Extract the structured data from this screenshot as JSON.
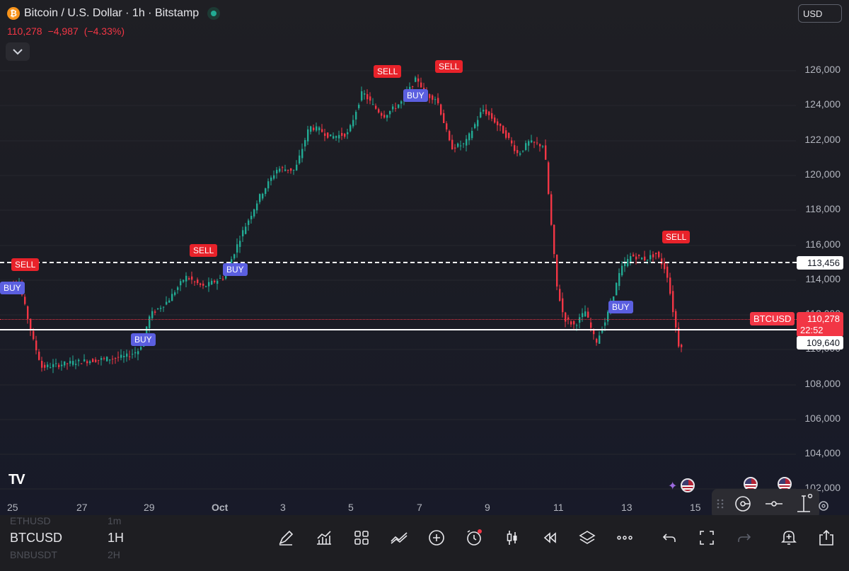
{
  "header": {
    "title": "Bitcoin / U.S. Dollar · 1h · Bitstamp",
    "last_price": "110,278",
    "change": "−4,987",
    "change_pct": "(−4.33%)",
    "currency": "USD",
    "logo_glyph": "₿"
  },
  "chart": {
    "y_ticks": [
      "126,000",
      "124,000",
      "122,000",
      "120,000",
      "118,000",
      "116,000",
      "114,000",
      "112,000",
      "110,000",
      "108,000",
      "106,000",
      "104,000",
      "102,000"
    ],
    "x_ticks": [
      "25",
      "27",
      "29",
      "Oct",
      "3",
      "5",
      "7",
      "9",
      "11",
      "13",
      "15"
    ],
    "price_tags": {
      "resistance": "113,456",
      "support": "109,640",
      "symbol": "BTCUSD",
      "current": "110,278",
      "countdown": "22:52"
    },
    "signals": [
      {
        "label": "SELL",
        "type": "sell"
      },
      {
        "label": "BUY",
        "type": "buy"
      },
      {
        "label": "BUY",
        "type": "buy"
      },
      {
        "label": "SELL",
        "type": "sell"
      },
      {
        "label": "BUY",
        "type": "buy"
      },
      {
        "label": "SELL",
        "type": "sell"
      },
      {
        "label": "BUY",
        "type": "buy"
      },
      {
        "label": "SELL",
        "type": "sell"
      },
      {
        "label": "BUY",
        "type": "buy"
      },
      {
        "label": "SELL",
        "type": "sell"
      }
    ],
    "colors": {
      "up": "#22ab94",
      "down": "#f23645",
      "buy": "#5b5fe0",
      "sell": "#e8222a"
    }
  },
  "watchlist": [
    {
      "symbol": "ETHUSD",
      "interval": "1m"
    },
    {
      "symbol": "BTCUSD",
      "interval": "1H"
    },
    {
      "symbol": "BNBUSDT",
      "interval": "2H"
    }
  ],
  "toolbar_icons": [
    "draw-icon",
    "indicators-icon",
    "layouts-icon",
    "compare-icon",
    "add-icon",
    "alert-icon",
    "candle-type-icon",
    "replay-icon",
    "layers-icon",
    "more-icon",
    "undo-icon",
    "fullscreen-icon",
    "redo-icon",
    "add-alert-icon",
    "share-icon"
  ],
  "drawing_toolbar_icons": [
    "drag-handle-icon",
    "cycle-icon",
    "horizontal-ray-icon",
    "vertical-measure-icon"
  ],
  "brand": "TV"
}
